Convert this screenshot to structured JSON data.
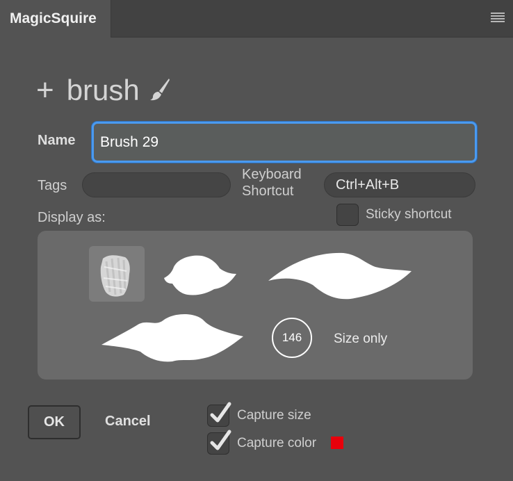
{
  "panel": {
    "tab_title": "MagicSquire",
    "menu_icon": "hamburger-menu-icon"
  },
  "heading": {
    "plus": "+",
    "text": "brush",
    "icon": "paintbrush-icon"
  },
  "form": {
    "name_label": "Name",
    "name_value": "Brush 29",
    "tags_label": "Tags",
    "tags_value": "",
    "shortcut_label_line1": "Keyboard",
    "shortcut_label_line2": "Shortcut",
    "shortcut_value": "Ctrl+Alt+B",
    "sticky_label": "Sticky shortcut",
    "sticky_checked": false,
    "display_label": "Display as:"
  },
  "display_options": {
    "selected": "brush-tip-preview",
    "size_value": "146",
    "size_only_label": "Size only"
  },
  "footer": {
    "ok_label": "OK",
    "cancel_label": "Cancel",
    "capture_size_label": "Capture size",
    "capture_size_checked": true,
    "capture_color_label": "Capture color",
    "capture_color_checked": true,
    "capture_color_swatch": "#e8000b"
  },
  "colors": {
    "accent_focus": "#4a9af0",
    "panel_bg": "#535353",
    "display_bg": "#6a6a6a"
  }
}
